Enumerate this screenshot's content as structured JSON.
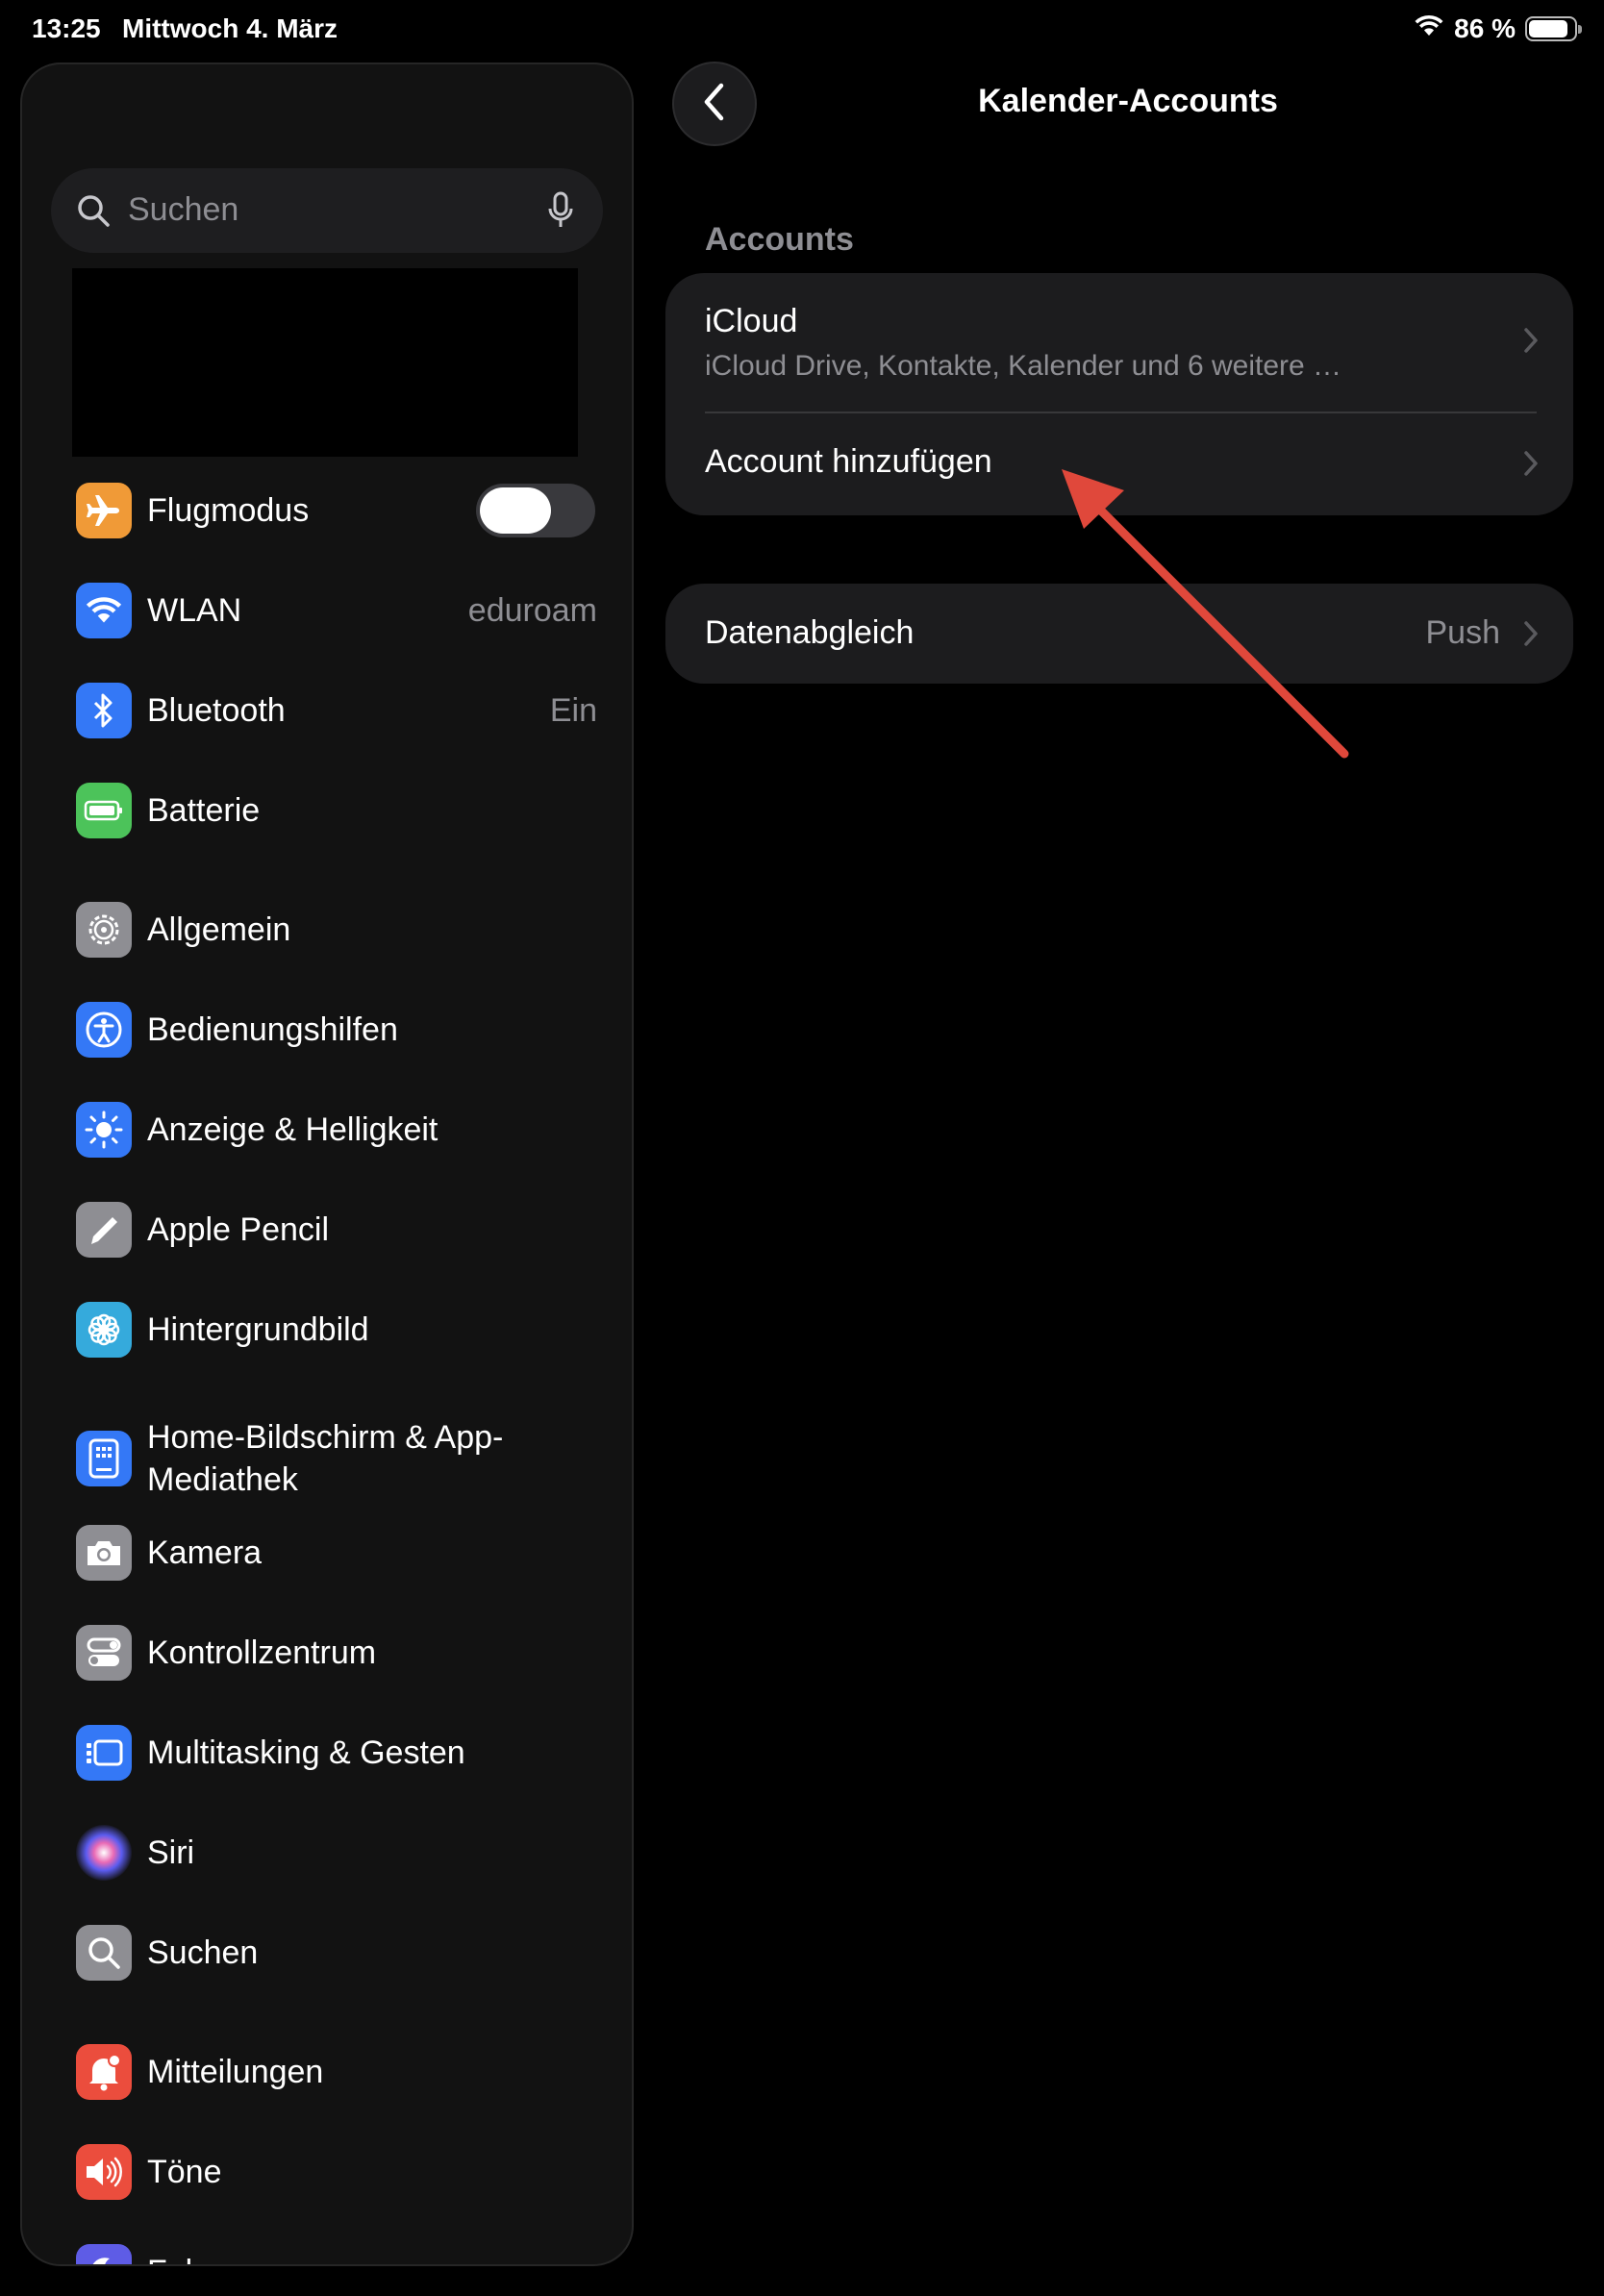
{
  "status_bar": {
    "time": "13:25",
    "date": "Mittwoch 4. März",
    "battery": "86 %",
    "battery_level": 0.86
  },
  "sidebar": {
    "search_placeholder": "Suchen",
    "items": [
      {
        "label": "Flugmodus",
        "icon": "airplane-icon",
        "color": "#f09a37",
        "toggle": false
      },
      {
        "label": "WLAN",
        "value": "eduroam",
        "icon": "wifi-icon",
        "color": "#3478f6"
      },
      {
        "label": "Bluetooth",
        "value": "Ein",
        "icon": "bluetooth-icon",
        "color": "#3478f6"
      },
      {
        "label": "Batterie",
        "icon": "battery-icon",
        "color": "#4cc35a"
      },
      {
        "label": "Allgemein",
        "icon": "gear-icon",
        "color": "#8e8e93"
      },
      {
        "label": "Bedienungshilfen",
        "icon": "accessibility-icon",
        "color": "#3478f6"
      },
      {
        "label": "Anzeige & Helligkeit",
        "icon": "sun-icon",
        "color": "#3478f6"
      },
      {
        "label": "Apple Pencil",
        "icon": "pencil-icon",
        "color": "#8e8e93"
      },
      {
        "label": "Hintergrundbild",
        "icon": "flower-icon",
        "color": "#35aadc"
      },
      {
        "label": "Home-Bildschirm & App-Mediathek",
        "label_line1": "Home-Bildschirm & App-",
        "label_line2": "Mediathek",
        "icon": "home-screen-icon",
        "color": "#3478f6"
      },
      {
        "label": "Kamera",
        "icon": "camera-icon",
        "color": "#8e8e93"
      },
      {
        "label": "Kontrollzentrum",
        "icon": "control-center-icon",
        "color": "#8e8e93"
      },
      {
        "label": "Multitasking & Gesten",
        "icon": "multitasking-icon",
        "color": "#3478f6"
      },
      {
        "label": "Siri",
        "icon": "siri-icon",
        "color": "#222"
      },
      {
        "label": "Suchen",
        "icon": "search-icon",
        "color": "#8e8e93"
      },
      {
        "label": "Mitteilungen",
        "icon": "bell-icon",
        "color": "#eb4d3d"
      },
      {
        "label": "Töne",
        "icon": "speaker-icon",
        "color": "#eb4d3d"
      },
      {
        "label": "Fokus",
        "icon": "moon-icon",
        "color": "#5e5ce6"
      }
    ]
  },
  "detail": {
    "title": "Kalender-Accounts",
    "section_header": "Accounts",
    "accounts": [
      {
        "title": "iCloud",
        "subtitle": "iCloud Drive, Kontakte, Kalender und 6 weitere …"
      },
      {
        "title": "Account hinzufügen"
      }
    ],
    "fetch": {
      "title": "Datenabgleich",
      "value": "Push"
    }
  },
  "colors": {
    "annotation_arrow": "#e0483b",
    "background": "#000000",
    "group_background": "#1c1c1e"
  }
}
